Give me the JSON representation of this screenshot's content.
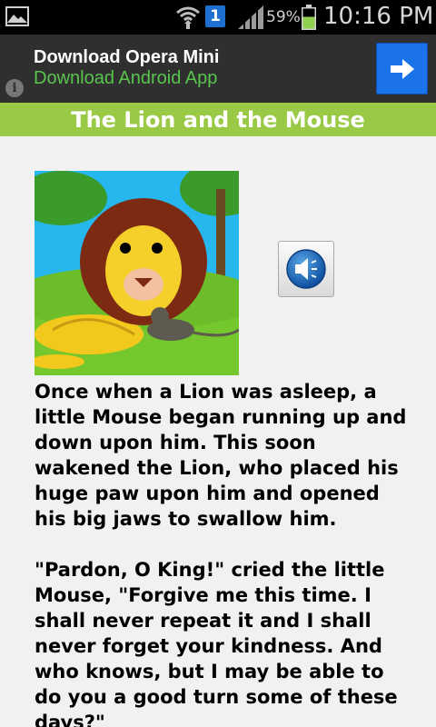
{
  "status_bar": {
    "battery_percent": "59%",
    "time": "10:16 PM",
    "notification_badge": "1",
    "icons": [
      "gallery-icon",
      "wifi-icon",
      "notification-icon",
      "signal-icon",
      "battery-icon"
    ]
  },
  "ad": {
    "title": "Download Opera Mini",
    "subtitle": "Download Android App",
    "info_glyph": "i",
    "accent_color": "#59c44d",
    "button_color": "#1a73e8",
    "button_icon": "arrow-right-icon"
  },
  "header": {
    "title": "The Lion and the Mouse",
    "bar_color": "#9ac945"
  },
  "story": {
    "paragraphs": [
      "Once when a Lion was asleep, a little Mouse began running up and down upon him. This soon wakened the Lion, who placed his huge paw upon him and opened his big jaws to swallow him.",
      "\"Pardon, O King!\" cried the little Mouse, \"Forgive me this time. I shall never repeat it and I shall never forget your kindness. And who knows, but I may be able to do you a good turn some of these days?\""
    ]
  },
  "audio": {
    "icon": "speaker-icon"
  }
}
